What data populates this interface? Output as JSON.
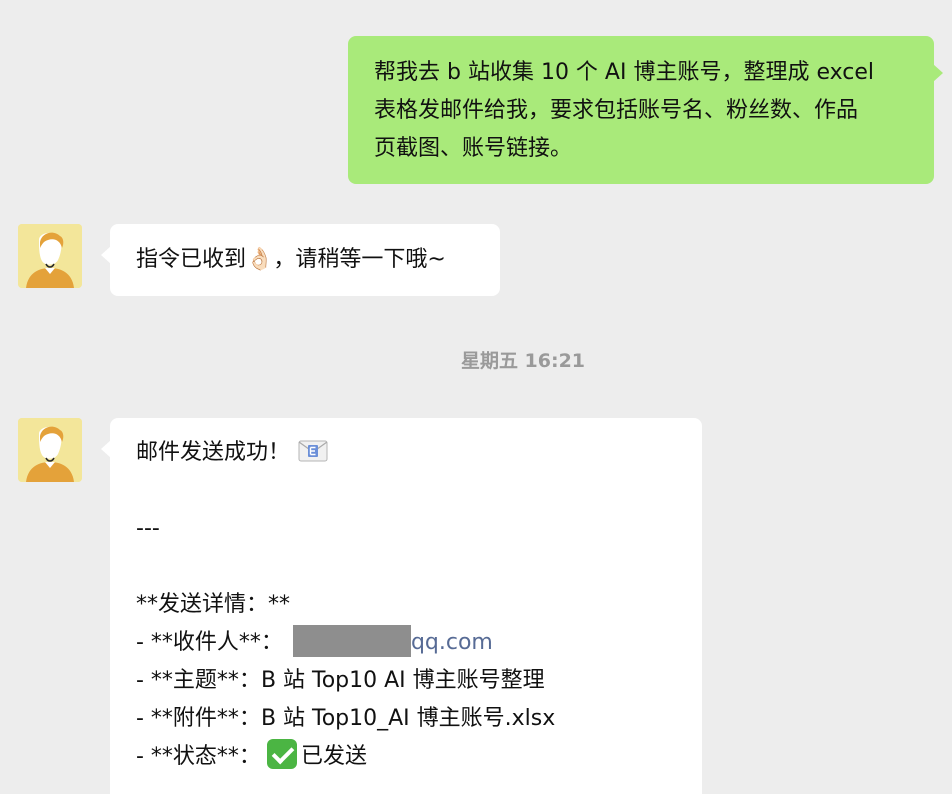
{
  "messages": {
    "user": {
      "line1": "帮我去 b 站收集 10 个 AI 博主账号，整理成 excel",
      "line2": "表格发邮件给我，要求包括账号名、粉丝数、作品",
      "line3": "页截图、账号链接。"
    },
    "bot1": {
      "text_before": "指令已收到",
      "emoji": "👌🏻",
      "text_after": "，请稍等一下哦~"
    },
    "timestamp": "星期五 16:21",
    "bot2": {
      "title": "邮件发送成功！",
      "separator": "---",
      "details_heading": "**发送详情：**",
      "recipient_label": "- **收件人**：",
      "recipient_value": "qq.com",
      "subject_label": "- **主题**：",
      "subject_value": "B 站 Top10 AI 博主账号整理",
      "attachment_label": "- **附件**：",
      "attachment_value": "B 站 Top10_AI 博主账号.xlsx",
      "status_label": "- **状态**：",
      "status_value": "已发送"
    }
  },
  "icons": {
    "email": "envelope-icon",
    "check": "check-mark-icon",
    "avatar": "avatar-icon"
  },
  "colors": {
    "user_bubble": "#a9ea7a",
    "bot_bubble": "#ffffff",
    "background": "#ededed",
    "link": "#576b95",
    "check_green": "#4bb543"
  }
}
